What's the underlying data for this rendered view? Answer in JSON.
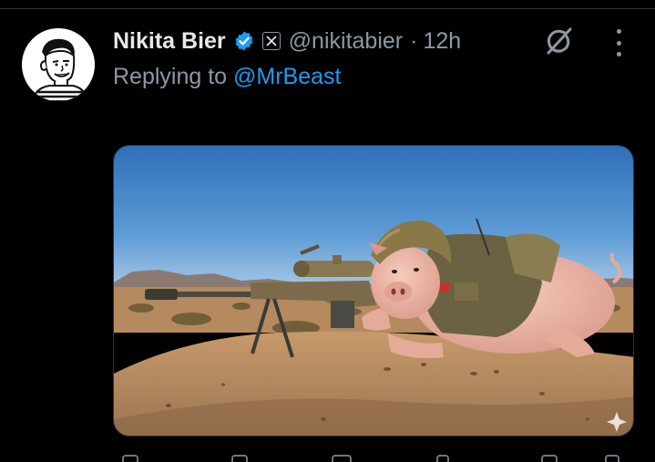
{
  "tweet": {
    "author": {
      "display_name": "Nikita Bier",
      "handle": "@nikitabier",
      "verified": true,
      "affiliate_badge_icon": "x-logo-icon",
      "avatar_icon": "cartoon-avatar"
    },
    "separator": "·",
    "timestamp": "12h",
    "reply": {
      "prefix": "Replying to",
      "mention": "@MrBeast"
    },
    "media": {
      "type": "image",
      "subject": "pig-sniper-image"
    }
  },
  "icons": {
    "verified": "verified-badge-icon",
    "grok": "grok-icon",
    "more": "more-options-icon"
  },
  "colors": {
    "background": "#000000",
    "text_primary": "#e7e9ea",
    "text_secondary": "#8b98a5",
    "accent": "#1d9bf0",
    "divider": "#2f3336"
  }
}
